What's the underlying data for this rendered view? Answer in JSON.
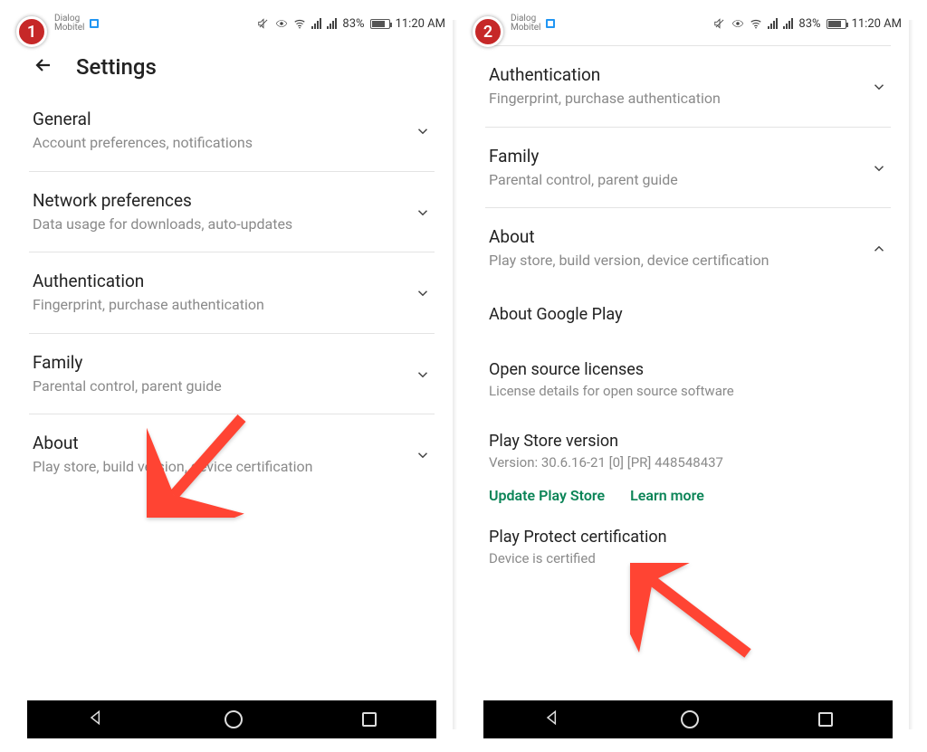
{
  "status": {
    "carrier1": "Dialog",
    "carrier2": "Mobitel",
    "battery_pct": "83%",
    "time": "11:20 AM"
  },
  "left": {
    "step": "1",
    "header_title": "Settings",
    "items": [
      {
        "title": "General",
        "sub": "Account preferences, notifications"
      },
      {
        "title": "Network preferences",
        "sub": "Data usage for downloads, auto-updates"
      },
      {
        "title": "Authentication",
        "sub": "Fingerprint, purchase authentication"
      },
      {
        "title": "Family",
        "sub": "Parental control, parent guide"
      },
      {
        "title": "About",
        "sub": "Play store, build version, device certification"
      }
    ]
  },
  "right": {
    "step": "2",
    "items_top": [
      {
        "title": "Authentication",
        "sub": "Fingerprint, purchase authentication"
      },
      {
        "title": "Family",
        "sub": "Parental control, parent guide"
      },
      {
        "title": "About",
        "sub": "Play store, build version, device certification",
        "expanded": true
      }
    ],
    "about": {
      "heading1": "About Google Play",
      "licenses_title": "Open source licenses",
      "licenses_sub": "License details for open source software",
      "version_title": "Play Store version",
      "version_sub": "Version: 30.6.16-21 [0] [PR] 448548437",
      "update_label": "Update Play Store",
      "learn_label": "Learn more",
      "protect_title": "Play Protect certification",
      "protect_sub": "Device is certified"
    }
  }
}
